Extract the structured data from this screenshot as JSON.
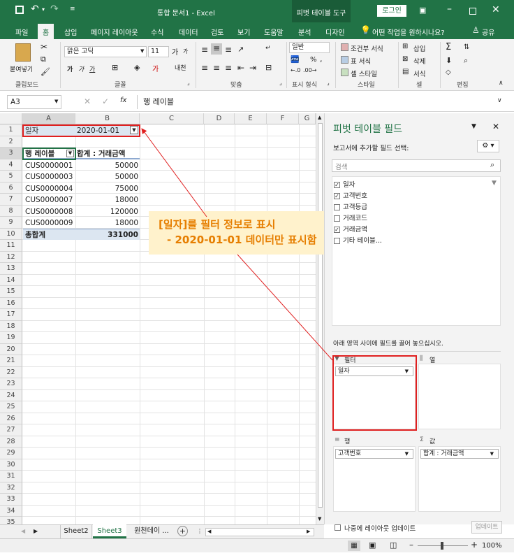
{
  "window": {
    "title": "통합 문서1 - Excel",
    "context_tab": "피벗 테이블 도구",
    "login": "로그인",
    "share": "공유",
    "search_hint": "어떤 작업을 원하시나요?"
  },
  "ribbon_tabs": [
    "파일",
    "홈",
    "삽입",
    "페이지 레이아웃",
    "수식",
    "데이터",
    "검토",
    "보기",
    "도움말",
    "분석",
    "디자인"
  ],
  "ribbon": {
    "paste": "붙여넣기",
    "font_name": "맑은 고딕",
    "font_size": "11",
    "number_format": "일반",
    "conditional_format": "조건부 서식",
    "table_format": "표 서식",
    "cell_style": "셀 스타일",
    "insert": "삽입",
    "delete": "삭제",
    "format": "서식",
    "groups": [
      "클립보드",
      "글꼴",
      "맞춤",
      "표시 형식",
      "스타일",
      "셀",
      "편집"
    ]
  },
  "formula_bar": {
    "name_box": "A3",
    "fx": "fx",
    "content": "행 레이블"
  },
  "columns": [
    "A",
    "B",
    "C",
    "D",
    "E",
    "F",
    "G"
  ],
  "rows": [
    "1",
    "2",
    "3",
    "4",
    "5",
    "6",
    "7",
    "8",
    "9",
    "10",
    "11",
    "12",
    "13",
    "14",
    "15",
    "16",
    "17",
    "18",
    "19",
    "20",
    "21",
    "22",
    "23",
    "24",
    "25",
    "26",
    "27",
    "28",
    "29",
    "30",
    "31",
    "32",
    "33",
    "34",
    "35"
  ],
  "pivot": {
    "filter_label": "일자",
    "filter_value": "2020-01-01",
    "header_row_label": "행 레이블",
    "header_sum": "합계 : 거래금액",
    "data": [
      {
        "id": "CUS0000001",
        "amount": "50000"
      },
      {
        "id": "CUS0000003",
        "amount": "50000"
      },
      {
        "id": "CUS0000004",
        "amount": "75000"
      },
      {
        "id": "CUS0000007",
        "amount": "18000"
      },
      {
        "id": "CUS0000008",
        "amount": "120000"
      },
      {
        "id": "CUS0000009",
        "amount": "18000"
      }
    ],
    "total_label": "총합계",
    "total_value": "331000"
  },
  "callout": {
    "line1": "[일자]를 필터 정보로 표시",
    "line2": "- 2020-01-01 데이터만 표시함"
  },
  "panel": {
    "title": "피벗 테이블 필드",
    "subtitle": "보고서에 추가할 필드 선택:",
    "search_placeholder": "검색",
    "fields": [
      {
        "name": "일자",
        "checked": true
      },
      {
        "name": "고객번호",
        "checked": true
      },
      {
        "name": "고객등급",
        "checked": false
      },
      {
        "name": "거래코드",
        "checked": false
      },
      {
        "name": "거래금액",
        "checked": true
      },
      {
        "name": "기타 테이블...",
        "checked": false
      }
    ],
    "drag_hint": "아래 영역 사이에 필드를 끌어 놓으십시오.",
    "area_filter": "필터",
    "area_columns": "열",
    "area_rows": "행",
    "area_values": "값",
    "filter_item": "일자",
    "row_item": "고객번호",
    "value_item": "합계 : 거래금액",
    "defer_label": "나중에 레이아웃 업데이트",
    "update_button": "업데이트"
  },
  "sheets": [
    "Sheet2",
    "Sheet3",
    "원천데이 ..."
  ],
  "active_sheet": "Sheet3",
  "status": {
    "zoom": "100%"
  },
  "colors": {
    "excel_green": "#217346",
    "filter_highlight": "#dce6f1",
    "callout_bg": "#fff2cc",
    "callout_text": "#e67e00",
    "annotation_red": "#e02020"
  }
}
